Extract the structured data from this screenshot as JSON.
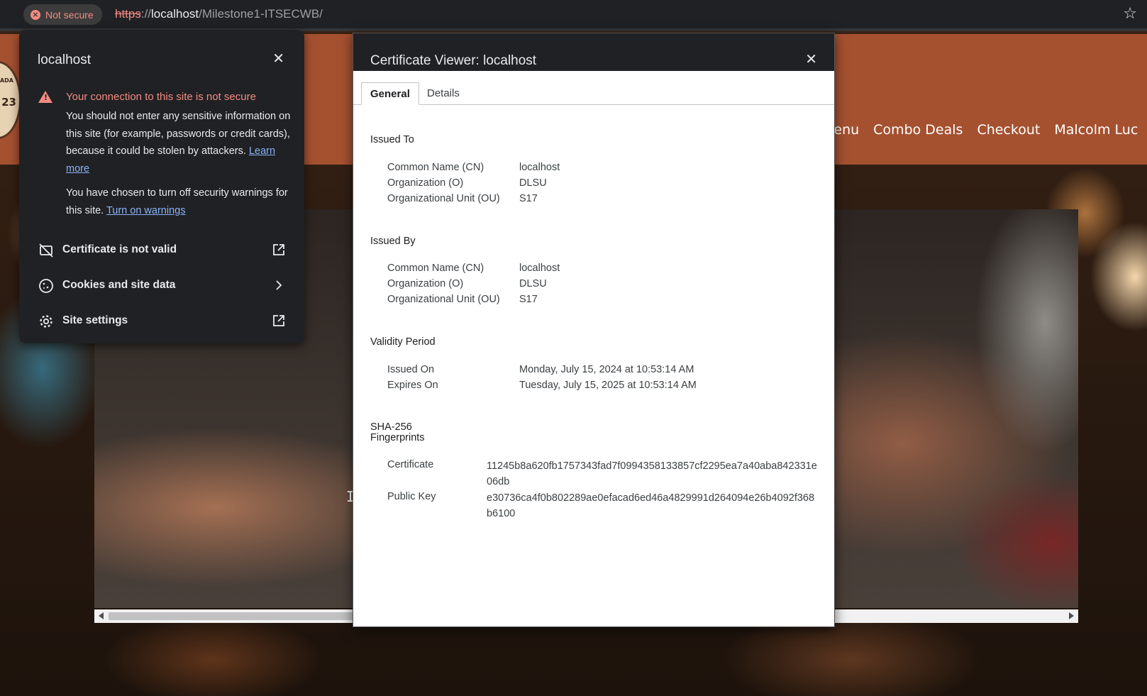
{
  "browser": {
    "security_chip": "Not secure",
    "url_scheme": "https",
    "url_sep": "://",
    "url_host": "localhost",
    "url_path": "/Milestone1-ITSECWB/"
  },
  "site": {
    "logo_text": "23",
    "logo_top": "KADA",
    "nav": [
      "Menu",
      "Combo Deals",
      "Checkout",
      "Malcolm Luc"
    ],
    "hero_cursor": "I"
  },
  "site_info_popup": {
    "title": "localhost",
    "warning_title": "Your connection to this site is not secure",
    "warning_body": "You should not enter any sensitive information on this site (for example, passwords or credit cards), because it could be stolen by attackers.",
    "learn_more": "Learn more",
    "choice_text": "You have chosen to turn off security warnings for this site.",
    "turn_on_warnings": "Turn on warnings",
    "rows": [
      {
        "label": "Certificate is not valid",
        "icon": "certificate-invalid-icon",
        "trail": "open-external-icon"
      },
      {
        "label": "Cookies and site data",
        "icon": "cookie-icon",
        "trail": "chevron-right-icon"
      },
      {
        "label": "Site settings",
        "icon": "gear-icon",
        "trail": "open-external-icon"
      }
    ]
  },
  "certificate_viewer": {
    "title": "Certificate Viewer: localhost",
    "tabs": [
      "General",
      "Details"
    ],
    "issued_to": {
      "heading": "Issued To",
      "rows": [
        {
          "key": "Common Name (CN)",
          "value": "localhost"
        },
        {
          "key": "Organization (O)",
          "value": "DLSU"
        },
        {
          "key": "Organizational Unit (OU)",
          "value": "S17"
        }
      ]
    },
    "issued_by": {
      "heading": "Issued By",
      "rows": [
        {
          "key": "Common Name (CN)",
          "value": "localhost"
        },
        {
          "key": "Organization (O)",
          "value": "DLSU"
        },
        {
          "key": "Organizational Unit (OU)",
          "value": "S17"
        }
      ]
    },
    "validity": {
      "heading": "Validity Period",
      "rows": [
        {
          "key": "Issued On",
          "value": "Monday, July 15, 2024 at 10:53:14 AM"
        },
        {
          "key": "Expires On",
          "value": "Tuesday, July 15, 2025 at 10:53:14 AM"
        }
      ]
    },
    "fingerprints": {
      "heading_line1": "SHA-256",
      "heading_line2": "Fingerprints",
      "rows": [
        {
          "key": "Certificate",
          "value": "11245b8a620fb1757343fad7f0994358133857cf2295ea7a40aba842331e06db"
        },
        {
          "key": "Public Key",
          "value": "e30736ca4f0b802289ae0efacad6ed46a4829991d264094e26b4092f368b6100"
        }
      ]
    }
  },
  "colors": {
    "header_brown": "#a55130",
    "warning_red": "#f28b82",
    "link_blue": "#8ab4f8",
    "dialog_dark": "#202124"
  }
}
